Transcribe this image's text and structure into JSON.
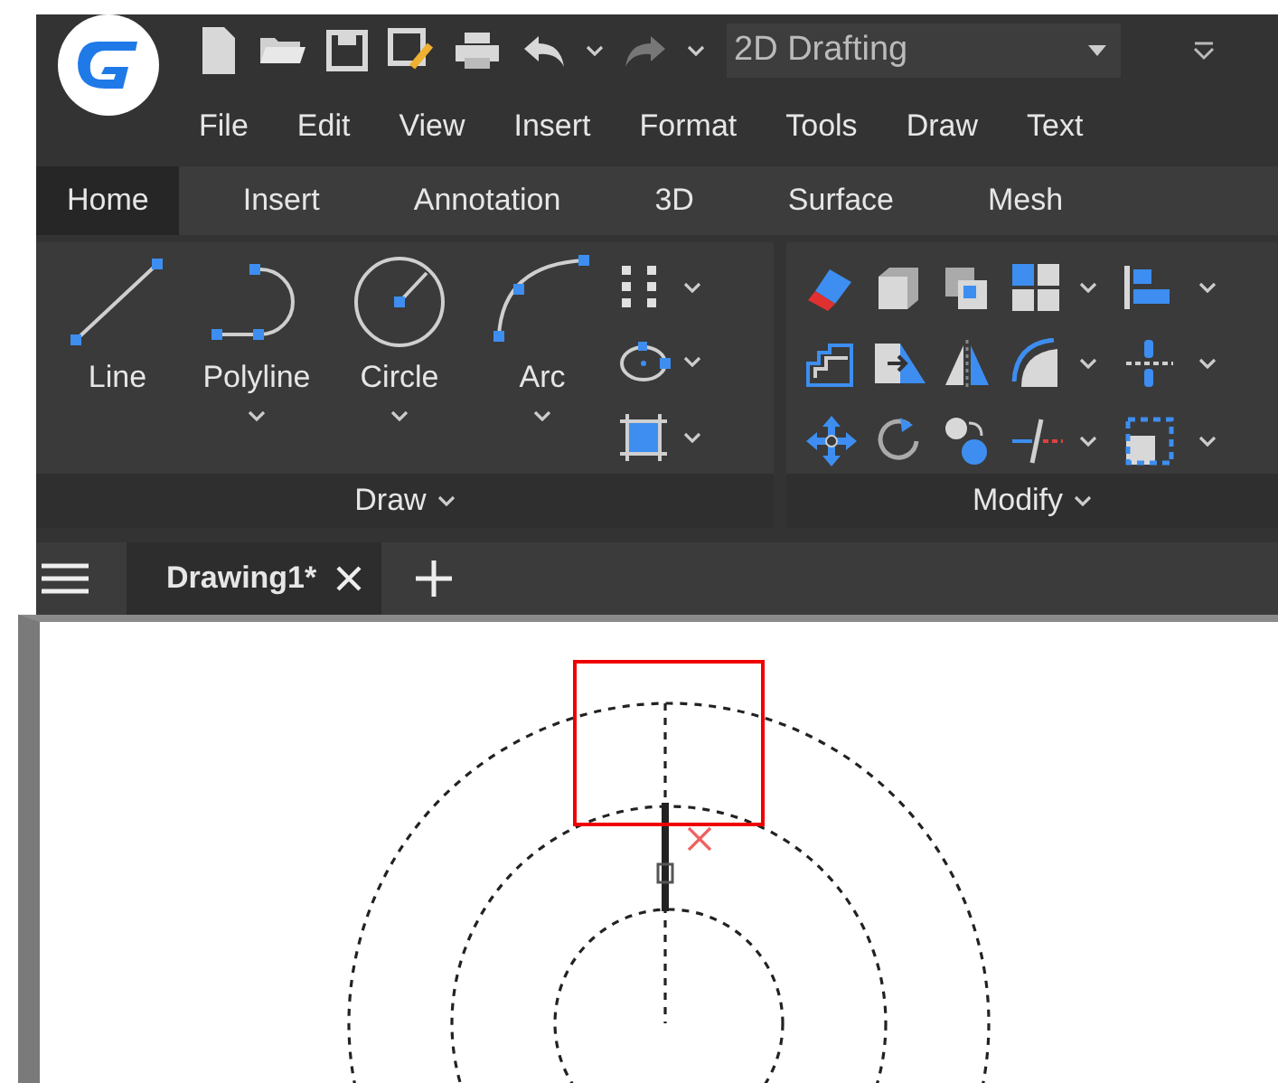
{
  "quick_access": {
    "workspace": "2D Drafting"
  },
  "menu": [
    {
      "label": "File"
    },
    {
      "label": "Edit"
    },
    {
      "label": "View"
    },
    {
      "label": "Insert"
    },
    {
      "label": "Format"
    },
    {
      "label": "Tools"
    },
    {
      "label": "Draw"
    },
    {
      "label": "Text"
    }
  ],
  "ribbon_tabs": [
    {
      "label": "Home",
      "selected": true
    },
    {
      "label": "Insert",
      "selected": false
    },
    {
      "label": "Annotation",
      "selected": false
    },
    {
      "label": "3D",
      "selected": false
    },
    {
      "label": "Surface",
      "selected": false
    },
    {
      "label": "Mesh",
      "selected": false
    }
  ],
  "ribbon_panels": [
    {
      "kind": "draw",
      "title": "Draw",
      "tools": [
        {
          "label": "Line",
          "has_dropdown": false
        },
        {
          "label": "Polyline",
          "has_dropdown": true
        },
        {
          "label": "Circle",
          "has_dropdown": true
        },
        {
          "label": "Arc",
          "has_dropdown": true
        }
      ]
    },
    {
      "kind": "modify",
      "title": "Modify"
    }
  ],
  "document_tabs": [
    {
      "label": "Drawing1*",
      "selected": true
    }
  ]
}
